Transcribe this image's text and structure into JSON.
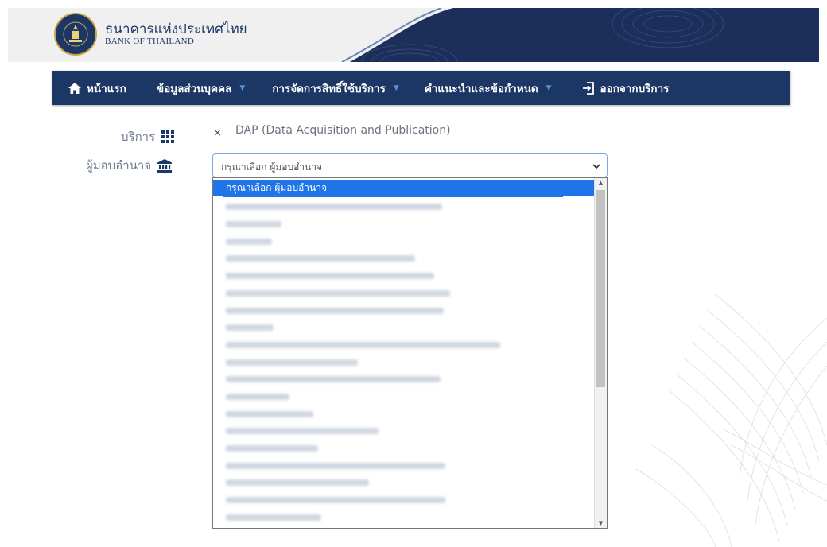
{
  "header": {
    "bank_name_th": "ธนาคารแห่งประเทศไทย",
    "bank_name_en": "BANK OF THAILAND"
  },
  "navbar": {
    "items": [
      {
        "label": "หน้าแรก",
        "icon": "home-icon",
        "dropdown": false
      },
      {
        "label": "ข้อมูลส่วนบุคคล",
        "dropdown": true
      },
      {
        "label": "การจัดการสิทธิ์ใช้บริการ",
        "dropdown": true
      },
      {
        "label": "คำแนะนำและข้อกำหนด",
        "dropdown": true
      },
      {
        "label": "ออกจากบริการ",
        "icon": "logout-icon",
        "dropdown": false
      }
    ]
  },
  "form": {
    "service_label": "บริการ",
    "service_icon": "grid-icon",
    "service_remove": "×",
    "service_value": "DAP (Data Acquisition and Publication)",
    "authorizer_label": "ผู้มอบอำนาจ",
    "authorizer_icon": "bank-icon",
    "authorizer_select_value": "กรุณาเลือก ผู้มอบอำนาจ"
  },
  "dropdown": {
    "selected_option": "กรุณาเลือก ผู้มอบอำนาจ",
    "blurred_option_count": 20
  },
  "colors": {
    "navbar_bg": "#1c3666",
    "nav_caret": "#5a8fd6",
    "select_highlight": "#1f74e8",
    "label_text": "#6e7d91"
  }
}
